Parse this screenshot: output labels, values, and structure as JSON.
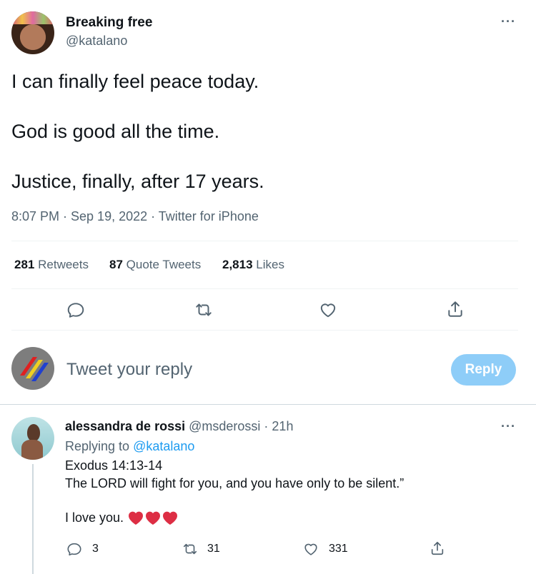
{
  "tweet": {
    "author_name": "Breaking free",
    "author_handle": "@katalano",
    "lines": [
      "I can finally feel peace today.",
      "God is good all the time.",
      "Justice, finally, after 17 years."
    ],
    "timestamp": "8:07 PM · Sep 19, 2022 · Twitter for iPhone",
    "stats": {
      "retweets_count": "281",
      "retweets_label": "Retweets",
      "quotes_count": "87",
      "quotes_label": "Quote Tweets",
      "likes_count": "2,813",
      "likes_label": "Likes"
    },
    "more": "···"
  },
  "compose": {
    "placeholder": "Tweet your reply",
    "reply_button": "Reply"
  },
  "reply": {
    "author_name": "alessandra de rossi",
    "author_handle": "@msderossi",
    "time": "· 21h",
    "replying_prefix": "Replying to",
    "replying_handle": "@katalano",
    "line1": "Exodus 14:13-14",
    "line2": "The LORD will fight for you, and you have only to be silent.”",
    "line3": "I love you.",
    "comment_count": "3",
    "retweet_count": "31",
    "like_count": "331",
    "more": "···"
  },
  "colors": {
    "accent": "#1d9bf0",
    "reply_button_bg": "#8ecdf8",
    "heart_red": "#e0245e"
  }
}
